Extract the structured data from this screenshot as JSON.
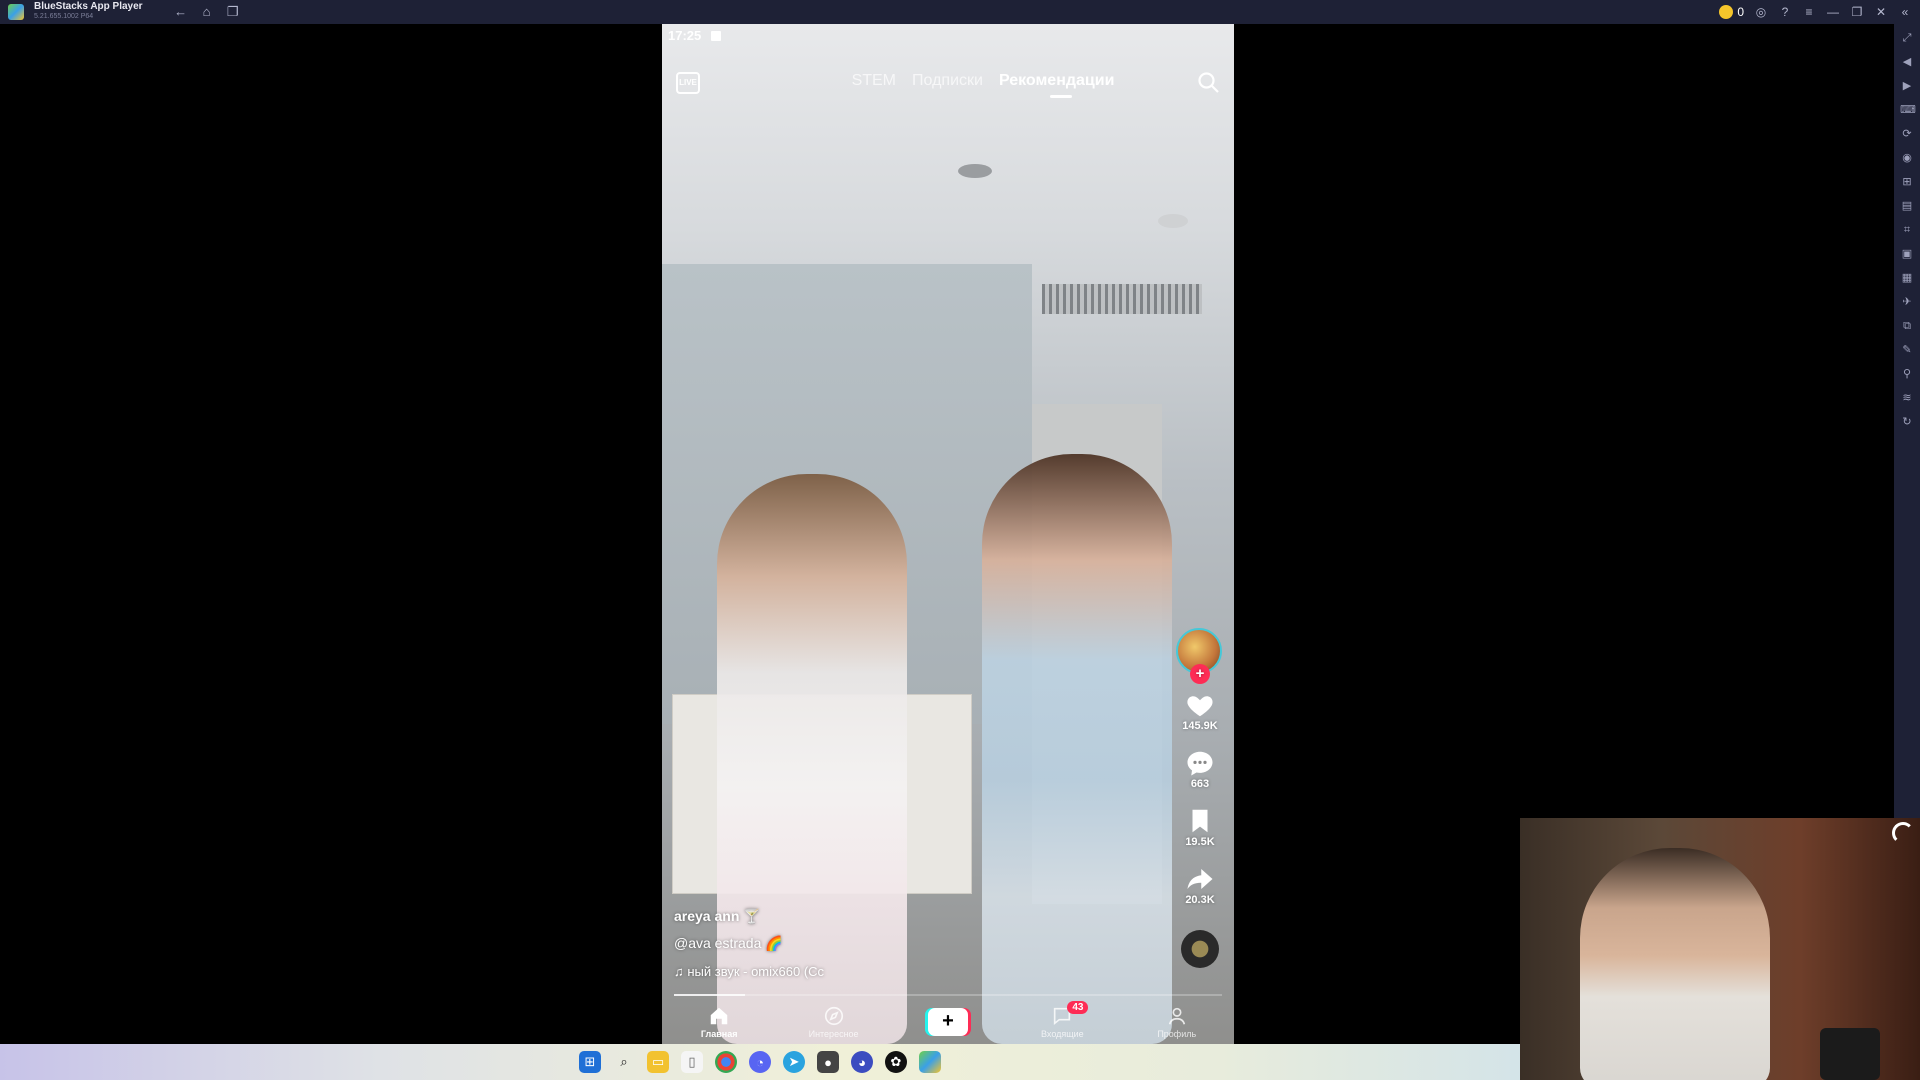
{
  "window": {
    "title": "BlueStacks App Player",
    "version": "5.21.655.1002  P64",
    "coins": "0"
  },
  "status_bar": {
    "time": "17:25"
  },
  "top_nav": {
    "live_label": "LIVE",
    "tabs": [
      {
        "label": "STEM",
        "active": false
      },
      {
        "label": "Подписки",
        "active": false
      },
      {
        "label": "Рекомендации",
        "active": true
      }
    ]
  },
  "actions": {
    "likes": "145.9K",
    "comments": "663",
    "saves": "19.5K",
    "shares": "20.3K"
  },
  "caption": {
    "author": "areya ann 🍸",
    "handle": "@ava estrada 🌈",
    "sound": "♫ ный звук - omix660 (Cc"
  },
  "progress": 0.13,
  "bottom_nav": {
    "items": [
      {
        "label": "Главная",
        "active": true
      },
      {
        "label": "Интересное",
        "active": false
      },
      {
        "label": "",
        "active": false
      },
      {
        "label": "Входящие",
        "active": false
      },
      {
        "label": "Профиль",
        "active": false
      }
    ],
    "inbox_badge": "43"
  },
  "colors": {
    "accent": "#fe2c55",
    "cyan": "#25f4ee",
    "titlebar": "#1e2136"
  }
}
